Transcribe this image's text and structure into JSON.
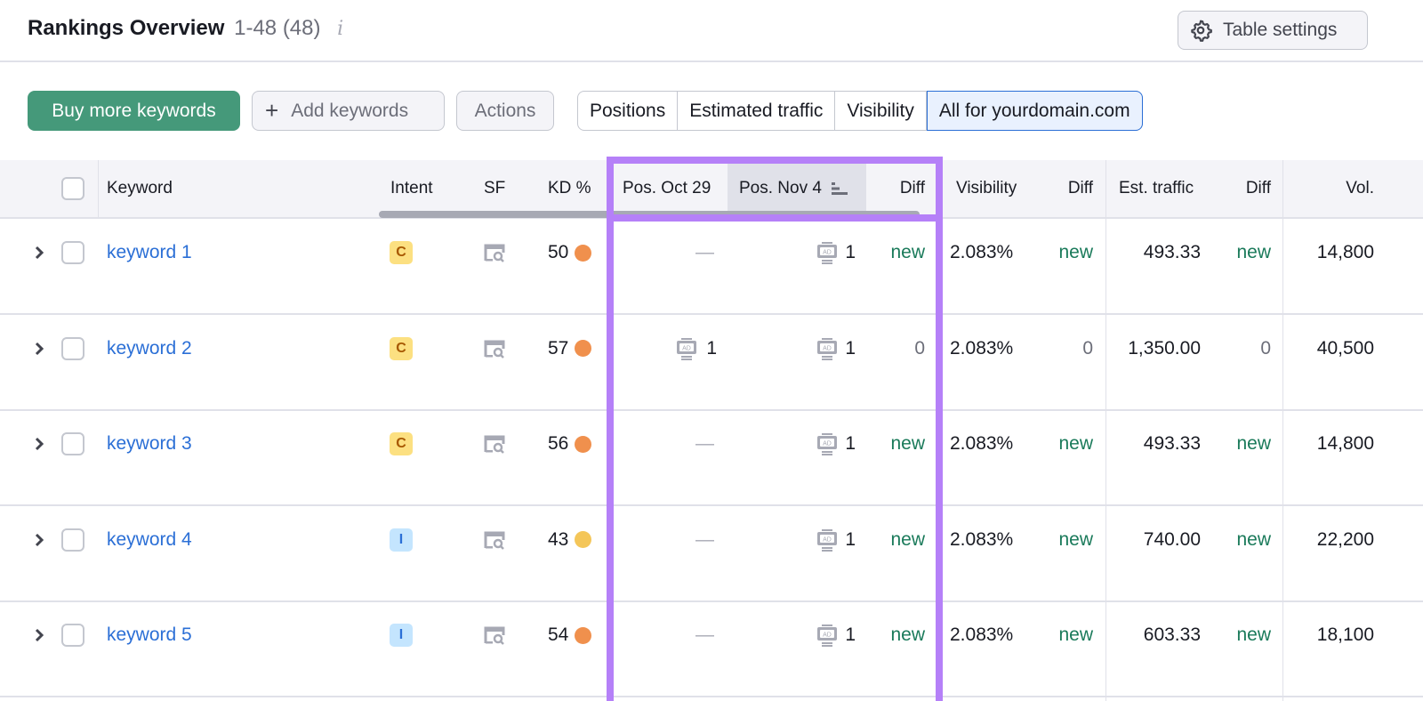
{
  "header": {
    "title": "Rankings Overview",
    "count": "1-48 (48)",
    "info_icon": "info-icon",
    "table_settings_label": "Table settings",
    "table_settings_icon": "gear-icon"
  },
  "toolbar": {
    "buy_label": "Buy more keywords",
    "add_label": "Add keywords",
    "add_icon": "plus-icon",
    "actions_label": "Actions",
    "segments": [
      {
        "label": "Positions",
        "active": false
      },
      {
        "label": "Estimated traffic",
        "active": false
      },
      {
        "label": "Visibility",
        "active": false
      },
      {
        "label": "All for yourdomain.com",
        "active": true
      }
    ]
  },
  "table": {
    "columns": {
      "keyword": "Keyword",
      "intent": "Intent",
      "sf": "SF",
      "kd": "KD %",
      "pos_prev": "Pos. Oct 29",
      "pos_curr": "Pos. Nov 4",
      "pos_diff": "Diff",
      "visibility": "Visibility",
      "vis_diff": "Diff",
      "traffic": "Est. traffic",
      "traffic_diff": "Diff",
      "volume": "Vol."
    },
    "sorted_column": "Pos. Nov 4",
    "rows": [
      {
        "keyword": "keyword 1",
        "intent": "C",
        "kd": "50",
        "kd_color": "#f0904d",
        "pos_prev": "—",
        "pos_prev_ad": false,
        "pos_curr": "1",
        "pos_diff": "new",
        "visibility": "2.083%",
        "vis_diff": "new",
        "traffic": "493.33",
        "traffic_diff": "new",
        "volume": "14,800"
      },
      {
        "keyword": "keyword 2",
        "intent": "C",
        "kd": "57",
        "kd_color": "#f0904d",
        "pos_prev": "1",
        "pos_prev_ad": true,
        "pos_curr": "1",
        "pos_diff": "0",
        "visibility": "2.083%",
        "vis_diff": "0",
        "traffic": "1,350.00",
        "traffic_diff": "0",
        "volume": "40,500"
      },
      {
        "keyword": "keyword 3",
        "intent": "C",
        "kd": "56",
        "kd_color": "#f0904d",
        "pos_prev": "—",
        "pos_prev_ad": false,
        "pos_curr": "1",
        "pos_diff": "new",
        "visibility": "2.083%",
        "vis_diff": "new",
        "traffic": "493.33",
        "traffic_diff": "new",
        "volume": "14,800"
      },
      {
        "keyword": "keyword 4",
        "intent": "I",
        "kd": "43",
        "kd_color": "#f4c659",
        "pos_prev": "—",
        "pos_prev_ad": false,
        "pos_curr": "1",
        "pos_diff": "new",
        "visibility": "2.083%",
        "vis_diff": "new",
        "traffic": "740.00",
        "traffic_diff": "new",
        "volume": "22,200"
      },
      {
        "keyword": "keyword 5",
        "intent": "I",
        "kd": "54",
        "kd_color": "#f0904d",
        "pos_prev": "—",
        "pos_prev_ad": false,
        "pos_curr": "1",
        "pos_diff": "new",
        "visibility": "2.083%",
        "vis_diff": "new",
        "traffic": "603.33",
        "traffic_diff": "new",
        "volume": "18,100"
      }
    ]
  },
  "colors": {
    "primary_green": "#45997a",
    "link_blue": "#2b6fd6",
    "highlight_purple": "#b580f8",
    "diff_new_green": "#1a7a5a"
  }
}
